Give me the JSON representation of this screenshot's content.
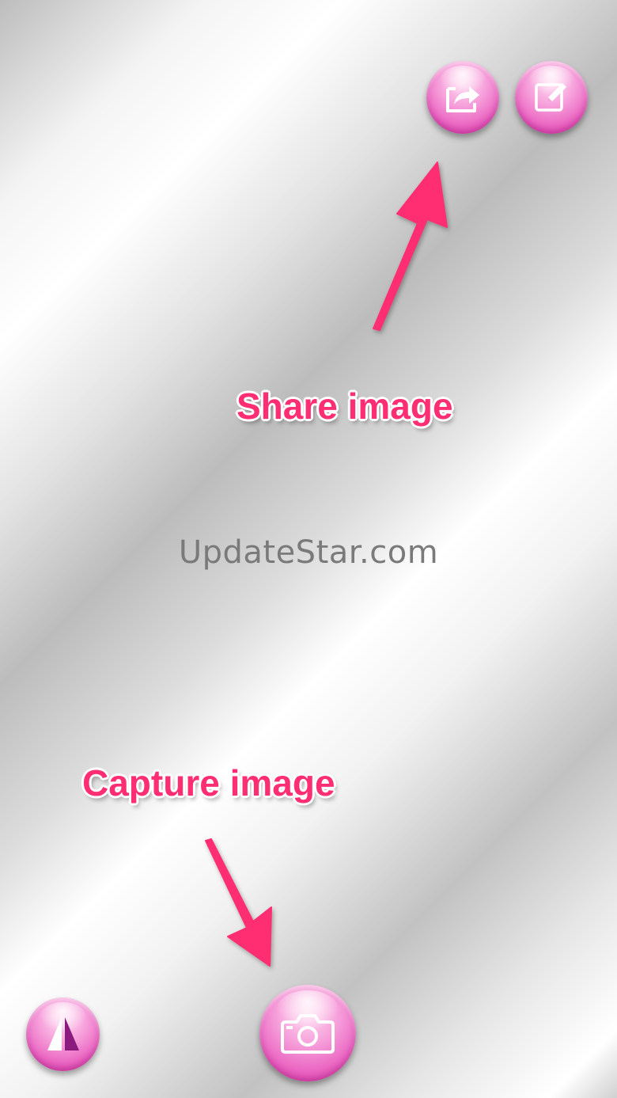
{
  "buttons": {
    "share": {
      "icon": "share-icon"
    },
    "edit": {
      "icon": "edit-icon"
    },
    "capture": {
      "icon": "camera-icon"
    },
    "flip": {
      "icon": "flip-icon"
    }
  },
  "callouts": {
    "share": "Share image",
    "capture": "Capture image"
  },
  "watermark": "UpdateStar.com",
  "colors": {
    "button_pink": "#ea64c1",
    "callout_pink": "#ff2e73",
    "flip_purple": "#8b1a7e"
  }
}
